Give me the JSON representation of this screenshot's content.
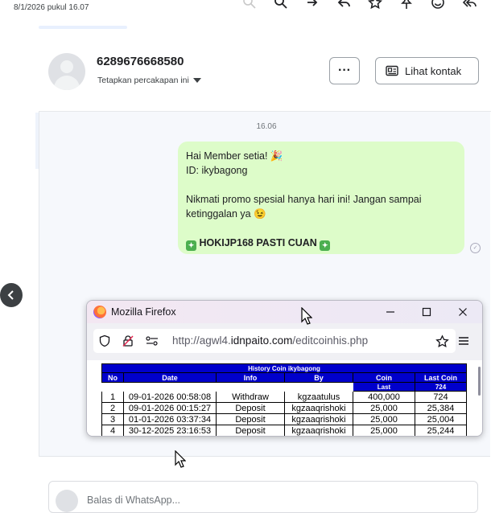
{
  "top": {
    "datetime": "8/1/2026 pukul 16.07"
  },
  "header": {
    "phone": "6289676668580",
    "assign_label": "Tetapkan percakapan ini",
    "more_label": "···",
    "contact_label": "Lihat kontak"
  },
  "chat": {
    "time": "16.06",
    "message": {
      "line1": "Hai Member setia! 🎉",
      "line2": "ID: ikybagong",
      "line3": "Nikmati promo spesial hanya hari ini! Jangan sampai ketinggalan ya 😉",
      "line4": "HOKIJP168 PASTI CUAN"
    }
  },
  "reply": {
    "placeholder": "Balas di WhatsApp..."
  },
  "firefox": {
    "title": "Mozilla Firefox",
    "url_prefix": "http://agwl4.",
    "url_domain": "idnpaito.com",
    "url_path": "/editcoinhis.php",
    "table": {
      "caption": "History Coin ikybagong",
      "headers": [
        "No",
        "Date",
        "Info",
        "By",
        "Coin",
        "Last Coin"
      ],
      "sub_coin": "Last",
      "sub_last": "724",
      "rows": [
        {
          "no": "1",
          "date": "09-01-2026 00:58:08",
          "info": "Withdraw",
          "by": "kgzaatulus",
          "coin": "400,000",
          "last": "724"
        },
        {
          "no": "2",
          "date": "09-01-2026 00:15:27",
          "info": "Deposit",
          "by": "kgzaaqrishoki",
          "coin": "25,000",
          "last": "25,384"
        },
        {
          "no": "3",
          "date": "01-01-2026 03:37:34",
          "info": "Deposit",
          "by": "kgzaaqrishoki",
          "coin": "25,000",
          "last": "25,004"
        },
        {
          "no": "4",
          "date": "30-12-2025 23:16:53",
          "info": "Deposit",
          "by": "kgzaaqrishoki",
          "coin": "25,000",
          "last": "25,244"
        }
      ]
    }
  }
}
